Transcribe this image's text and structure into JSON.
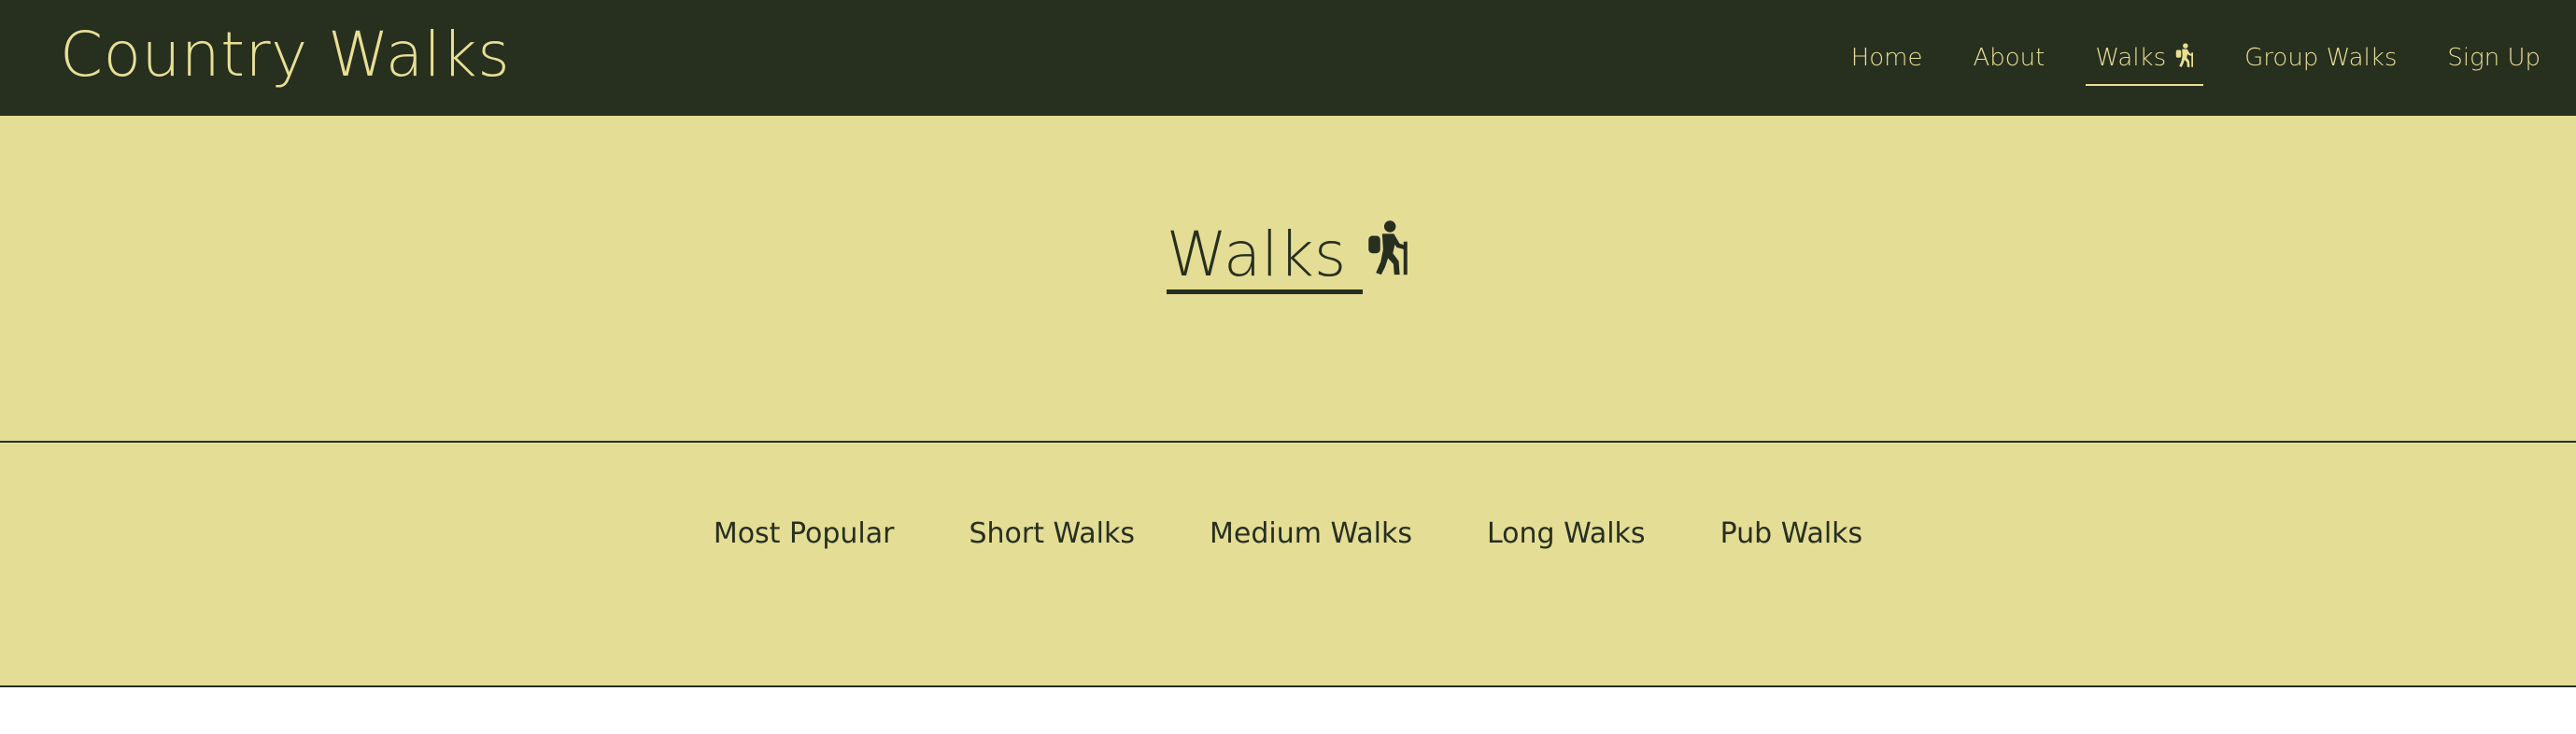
{
  "app": {
    "brand": "Country Walks"
  },
  "nav": {
    "items": [
      {
        "label": "Home"
      },
      {
        "label": "About"
      },
      {
        "label": "Walks"
      },
      {
        "label": "Group Walks"
      },
      {
        "label": "Sign Up"
      }
    ],
    "active_index": 2
  },
  "hero": {
    "title": "Walks",
    "icon": "hiker-icon"
  },
  "categories": {
    "items": [
      {
        "label": "Most Popular"
      },
      {
        "label": "Short Walks"
      },
      {
        "label": "Medium Walks"
      },
      {
        "label": "Long Walks"
      },
      {
        "label": "Pub Walks"
      }
    ]
  },
  "colors": {
    "navbar_bg": "#272f1f",
    "accent_text": "#e8df95",
    "section_bg": "#e4dd95",
    "dark_text": "#272f1f"
  }
}
